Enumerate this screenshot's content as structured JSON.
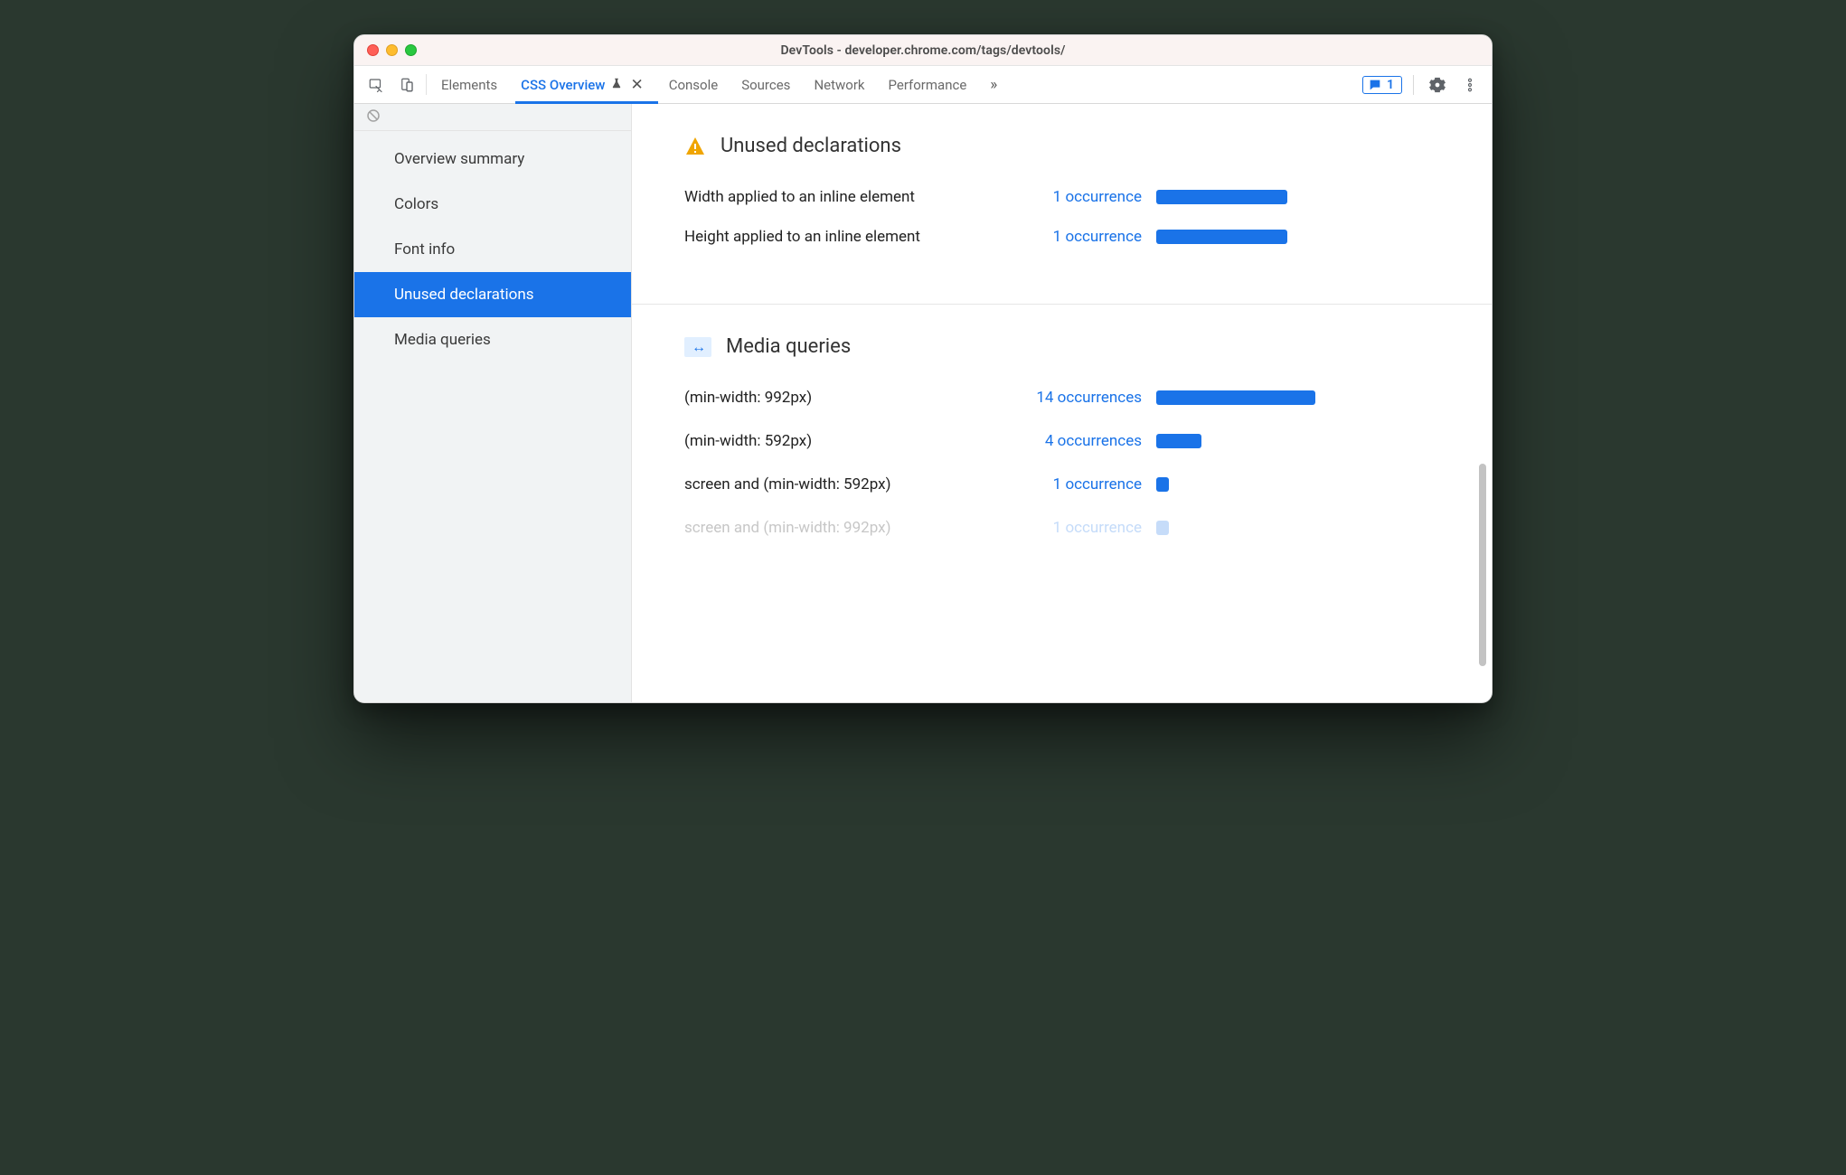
{
  "window_title": "DevTools - developer.chrome.com/tags/devtools/",
  "toolbar": {
    "tabs": [
      {
        "label": "Elements"
      },
      {
        "label": "CSS Overview"
      },
      {
        "label": "Console"
      },
      {
        "label": "Sources"
      },
      {
        "label": "Network"
      },
      {
        "label": "Performance"
      }
    ],
    "active_tab_index": 1,
    "issues_count": "1"
  },
  "sidebar": {
    "items": [
      {
        "label": "Overview summary"
      },
      {
        "label": "Colors"
      },
      {
        "label": "Font info"
      },
      {
        "label": "Unused declarations"
      },
      {
        "label": "Media queries"
      }
    ],
    "selected_index": 3
  },
  "sections": {
    "unused": {
      "title": "Unused declarations",
      "rows": [
        {
          "label": "Width applied to an inline element",
          "occ": "1 occurrence",
          "bar": 145
        },
        {
          "label": "Height applied to an inline element",
          "occ": "1 occurrence",
          "bar": 145
        }
      ]
    },
    "media": {
      "title": "Media queries",
      "rows": [
        {
          "label": "(min-width: 992px)",
          "occ": "14 occurrences",
          "bar": 176
        },
        {
          "label": "(min-width: 592px)",
          "occ": "4 occurrences",
          "bar": 50
        },
        {
          "label": "screen and (min-width: 592px)",
          "occ": "1 occurrence",
          "bar": 14
        },
        {
          "label": "screen and (min-width: 992px)",
          "occ": "1 occurrence",
          "bar": 14
        }
      ]
    }
  }
}
